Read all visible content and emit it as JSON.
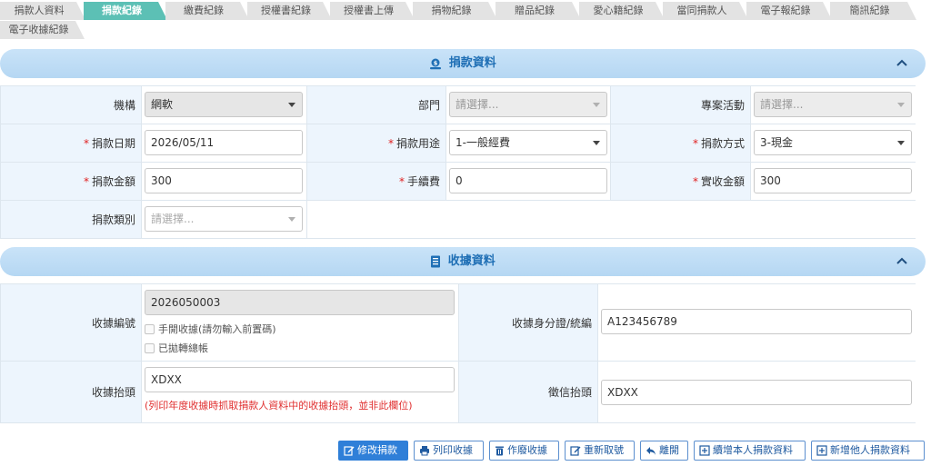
{
  "tabs": [
    {
      "label": "捐款人資料",
      "active": false
    },
    {
      "label": "捐款紀錄",
      "active": true
    },
    {
      "label": "繳費紀錄",
      "active": false
    },
    {
      "label": "授權書紀錄",
      "active": false
    },
    {
      "label": "授權書上傳",
      "active": false
    },
    {
      "label": "捐物紀錄",
      "active": false
    },
    {
      "label": "贈品紀錄",
      "active": false
    },
    {
      "label": "愛心籍紀錄",
      "active": false
    },
    {
      "label": "當同捐款人",
      "active": false
    },
    {
      "label": "電子報紀錄",
      "active": false
    },
    {
      "label": "簡訊紀錄",
      "active": false
    },
    {
      "label": "電子收據紀錄",
      "active": false
    }
  ],
  "donation_section": {
    "title": "捐款資料",
    "icon": "donation-icon",
    "org_label": "機構",
    "org_value": "網軟",
    "dept_label": "部門",
    "dept_placeholder": "請選擇...",
    "project_label": "專案活動",
    "project_placeholder": "請選擇...",
    "date_label": "捐款日期",
    "date_value": "2026/05/11",
    "purpose_label": "捐款用途",
    "purpose_value": "1-一般經費",
    "method_label": "捐款方式",
    "method_value": "3-現金",
    "amount_label": "捐款金額",
    "amount_value": "300",
    "fee_label": "手續費",
    "fee_value": "0",
    "net_label": "實收金額",
    "net_value": "300",
    "category_label": "捐款類別",
    "category_placeholder": "請選擇..."
  },
  "receipt_section": {
    "title": "收據資料",
    "icon": "receipt-icon",
    "no_label": "收據編號",
    "no_value": "2026050003",
    "manual_label": "手開收據(請勿輸入前置碼)",
    "transferred_label": "已拋轉總帳",
    "id_label": "收據身分證/統編",
    "id_value": "A123456789",
    "header_label": "收據抬頭",
    "header_value": "XDXX",
    "header_note": "(列印年度收據時抓取捐款人資料中的收據抬頭，並非此欄位)",
    "letter_label": "徵信抬頭",
    "letter_value": "XDXX"
  },
  "footer_buttons": [
    {
      "label": "修改捐款",
      "icon": "edit-icon",
      "primary": true
    },
    {
      "label": "列印收據",
      "icon": "print-icon",
      "primary": false
    },
    {
      "label": "作廢收據",
      "icon": "trash-icon",
      "primary": false
    },
    {
      "label": "重新取號",
      "icon": "edit-icon",
      "primary": false
    },
    {
      "label": "離開",
      "icon": "reply-icon",
      "primary": false
    },
    {
      "label": "續增本人捐款資料",
      "icon": "plus-square-icon",
      "primary": false
    },
    {
      "label": "新增他人捐款資料",
      "icon": "plus-square-icon",
      "primary": false
    }
  ],
  "colors": {
    "tab_active": "#5cc0b5",
    "section_header": "#c0ddf6",
    "label_bg": "#edf5fd",
    "primary_button": "#2f7fd8",
    "required": "#e02020"
  }
}
